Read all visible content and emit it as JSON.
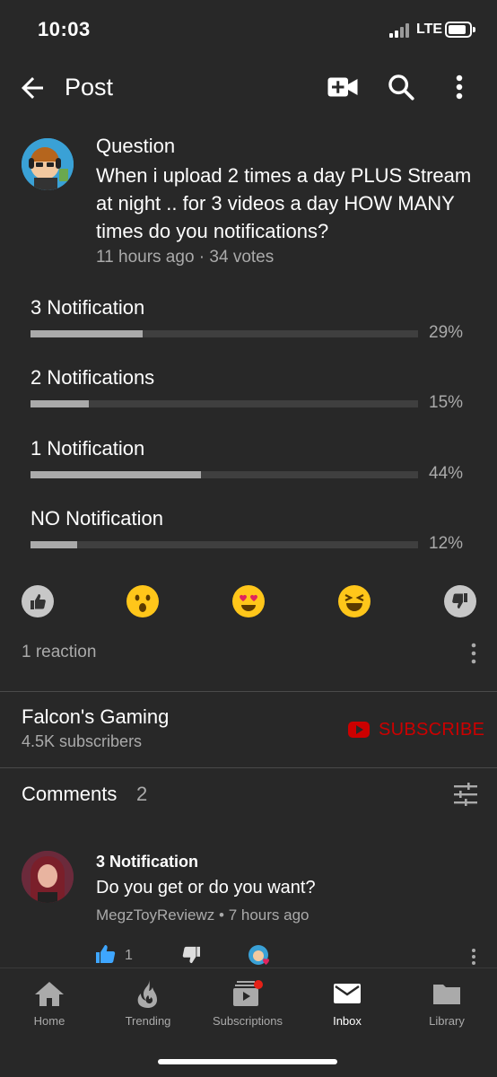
{
  "status_bar": {
    "time": "10:03",
    "network": "LTE",
    "signal_bars": 4,
    "battery_level": 0.75
  },
  "app_bar": {
    "title": "Post",
    "icons": [
      "back-arrow-icon",
      "add-video-icon",
      "search-icon",
      "more-vert-icon"
    ]
  },
  "post": {
    "type_label": "Question",
    "question": "When i upload 2 times a day PLUS Stream at night .. for 3 videos a day HOW MANY times do you notifications?",
    "time_ago": "11 hours ago",
    "separator": "·",
    "votes": "34 votes"
  },
  "poll": {
    "options": [
      {
        "label": "3 Notification",
        "percent_label": "29%",
        "percent": 29
      },
      {
        "label": "2 Notifications",
        "percent_label": "15%",
        "percent": 15
      },
      {
        "label": "1 Notification",
        "percent_label": "44%",
        "percent": 44
      },
      {
        "label": "NO Notification",
        "percent_label": "12%",
        "percent": 12
      }
    ]
  },
  "reactions": {
    "icons": [
      "thumbs-up-icon",
      "surprised-emoji-icon",
      "heart-eyes-emoji-icon",
      "laughing-emoji-icon",
      "thumbs-down-icon"
    ],
    "count_text": "1 reaction"
  },
  "channel": {
    "name": "Falcon's Gaming",
    "subscribers": "4.5K subscribers",
    "subscribe_label": "SUBSCRIBE"
  },
  "comments": {
    "title": "Comments",
    "count": "2",
    "items": [
      {
        "heading": "3 Notification",
        "text": "Do you get or do you want?",
        "author": "MegzToyReviewz",
        "meta_sep": "•",
        "time_ago": "7 hours ago",
        "likes": "1"
      }
    ]
  },
  "bottom_nav": {
    "active": "Inbox",
    "items": [
      {
        "label": "Home",
        "icon": "home-icon"
      },
      {
        "label": "Trending",
        "icon": "flame-icon"
      },
      {
        "label": "Subscriptions",
        "icon": "subscriptions-icon"
      },
      {
        "label": "Inbox",
        "icon": "mail-icon"
      },
      {
        "label": "Library",
        "icon": "folder-icon"
      }
    ]
  },
  "colors": {
    "background": "#282828",
    "text_primary": "#ffffff",
    "text_secondary": "#aaaaaa",
    "accent_red": "#cc0000",
    "like_blue": "#3ea6ff"
  }
}
